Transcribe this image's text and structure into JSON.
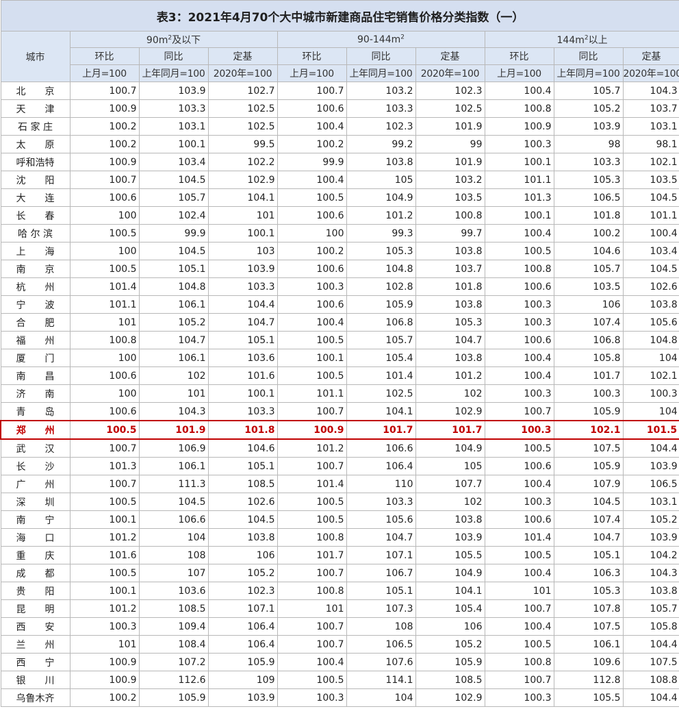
{
  "title": "表3：2021年4月70个大中城市新建商品住宅销售价格分类指数（一）",
  "city_header": "城市",
  "groups": [
    {
      "pre": "90m",
      "sup": "2",
      "post": "及以下"
    },
    {
      "pre": "90-144m",
      "sup": "2",
      "post": ""
    },
    {
      "pre": "144m",
      "sup": "2",
      "post": "以上"
    }
  ],
  "sub_headers": [
    "环比",
    "同比",
    "定基",
    "环比",
    "同比",
    "定基",
    "环比",
    "同比",
    "定基"
  ],
  "base_headers": [
    "上月=100",
    "上年同月=100",
    "2020年=100",
    "上月=100",
    "上年同月=100",
    "2020年=100",
    "上月=100",
    "上年同月=100",
    "2020年=100"
  ],
  "highlight_color": "#c00000",
  "rows": [
    {
      "city": "北　　京",
      "v": [
        "100.7",
        "103.9",
        "102.7",
        "100.7",
        "103.2",
        "102.3",
        "100.4",
        "105.7",
        "104.3"
      ]
    },
    {
      "city": "天　　津",
      "v": [
        "100.9",
        "103.3",
        "102.5",
        "100.6",
        "103.3",
        "102.5",
        "100.8",
        "105.2",
        "103.7"
      ]
    },
    {
      "city": "石 家 庄",
      "v": [
        "100.2",
        "103.1",
        "102.5",
        "100.4",
        "102.3",
        "101.9",
        "100.9",
        "103.9",
        "103.1"
      ]
    },
    {
      "city": "太　　原",
      "v": [
        "100.2",
        "100.1",
        "99.5",
        "100.2",
        "99.2",
        "99",
        "100.3",
        "98",
        "98.1"
      ]
    },
    {
      "city": "呼和浩特",
      "v": [
        "100.9",
        "103.4",
        "102.2",
        "99.9",
        "103.8",
        "101.9",
        "100.1",
        "103.3",
        "102.1"
      ]
    },
    {
      "city": "沈　　阳",
      "v": [
        "100.7",
        "104.5",
        "102.9",
        "100.4",
        "105",
        "103.2",
        "101.1",
        "105.3",
        "103.5"
      ]
    },
    {
      "city": "大　　连",
      "v": [
        "100.6",
        "105.7",
        "104.1",
        "100.5",
        "104.9",
        "103.5",
        "101.3",
        "106.5",
        "104.5"
      ]
    },
    {
      "city": "长　　春",
      "v": [
        "100",
        "102.4",
        "101",
        "100.6",
        "101.2",
        "100.8",
        "100.1",
        "101.8",
        "101.1"
      ]
    },
    {
      "city": "哈 尔 滨",
      "v": [
        "100.5",
        "99.9",
        "100.1",
        "100",
        "99.3",
        "99.7",
        "100.4",
        "100.2",
        "100.4"
      ]
    },
    {
      "city": "上　　海",
      "v": [
        "100",
        "104.5",
        "103",
        "100.2",
        "105.3",
        "103.8",
        "100.5",
        "104.6",
        "103.4"
      ]
    },
    {
      "city": "南　　京",
      "v": [
        "100.5",
        "105.1",
        "103.9",
        "100.6",
        "104.8",
        "103.7",
        "100.8",
        "105.7",
        "104.5"
      ]
    },
    {
      "city": "杭　　州",
      "v": [
        "101.4",
        "104.8",
        "103.3",
        "100.3",
        "102.8",
        "101.8",
        "100.6",
        "103.5",
        "102.6"
      ]
    },
    {
      "city": "宁　　波",
      "v": [
        "101.1",
        "106.1",
        "104.4",
        "100.6",
        "105.9",
        "103.8",
        "100.3",
        "106",
        "103.8"
      ]
    },
    {
      "city": "合　　肥",
      "v": [
        "101",
        "105.2",
        "104.7",
        "100.4",
        "106.8",
        "105.3",
        "100.3",
        "107.4",
        "105.6"
      ]
    },
    {
      "city": "福　　州",
      "v": [
        "100.8",
        "104.7",
        "105.1",
        "100.5",
        "105.7",
        "104.7",
        "100.6",
        "106.8",
        "104.8"
      ]
    },
    {
      "city": "厦　　门",
      "v": [
        "100",
        "106.1",
        "103.6",
        "100.1",
        "105.4",
        "103.8",
        "100.4",
        "105.8",
        "104"
      ]
    },
    {
      "city": "南　　昌",
      "v": [
        "100.6",
        "102",
        "101.6",
        "100.5",
        "101.4",
        "101.2",
        "100.4",
        "101.7",
        "102.1"
      ]
    },
    {
      "city": "济　　南",
      "v": [
        "100",
        "101",
        "100.1",
        "101.1",
        "102.5",
        "102",
        "100.3",
        "100.3",
        "100.3"
      ]
    },
    {
      "city": "青　　岛",
      "v": [
        "100.6",
        "104.3",
        "103.3",
        "100.7",
        "104.1",
        "102.9",
        "100.7",
        "105.9",
        "104"
      ]
    },
    {
      "city": "郑　　州",
      "highlight": true,
      "v": [
        "100.5",
        "101.9",
        "101.8",
        "100.9",
        "101.7",
        "101.7",
        "100.3",
        "102.1",
        "101.5"
      ]
    },
    {
      "city": "武　　汉",
      "v": [
        "100.7",
        "106.9",
        "104.6",
        "101.2",
        "106.6",
        "104.9",
        "100.5",
        "107.5",
        "104.4"
      ]
    },
    {
      "city": "长　　沙",
      "v": [
        "101.3",
        "106.1",
        "105.1",
        "100.7",
        "106.4",
        "105",
        "100.6",
        "105.9",
        "103.9"
      ]
    },
    {
      "city": "广　　州",
      "v": [
        "100.7",
        "111.3",
        "108.5",
        "101.4",
        "110",
        "107.7",
        "100.4",
        "107.9",
        "106.5"
      ]
    },
    {
      "city": "深　　圳",
      "v": [
        "100.5",
        "104.5",
        "102.6",
        "100.5",
        "103.3",
        "102",
        "100.3",
        "104.5",
        "103.1"
      ]
    },
    {
      "city": "南　　宁",
      "v": [
        "100.1",
        "106.6",
        "104.5",
        "100.5",
        "105.6",
        "103.8",
        "100.6",
        "107.4",
        "105.2"
      ]
    },
    {
      "city": "海　　口",
      "v": [
        "101.2",
        "104",
        "103.8",
        "100.8",
        "104.7",
        "103.9",
        "101.4",
        "104.7",
        "103.9"
      ]
    },
    {
      "city": "重　　庆",
      "v": [
        "101.6",
        "108",
        "106",
        "101.7",
        "107.1",
        "105.5",
        "100.5",
        "105.1",
        "104.2"
      ]
    },
    {
      "city": "成　　都",
      "v": [
        "100.5",
        "107",
        "105.2",
        "100.7",
        "106.7",
        "104.9",
        "100.4",
        "106.3",
        "104.3"
      ]
    },
    {
      "city": "贵　　阳",
      "v": [
        "100.1",
        "103.6",
        "102.3",
        "100.8",
        "105.1",
        "104.1",
        "101",
        "105.3",
        "103.8"
      ]
    },
    {
      "city": "昆　　明",
      "v": [
        "101.2",
        "108.5",
        "107.1",
        "101",
        "107.3",
        "105.4",
        "100.7",
        "107.8",
        "105.7"
      ]
    },
    {
      "city": "西　　安",
      "v": [
        "100.3",
        "109.4",
        "106.4",
        "100.7",
        "108",
        "106",
        "100.4",
        "107.5",
        "105.8"
      ]
    },
    {
      "city": "兰　　州",
      "v": [
        "101",
        "108.4",
        "106.4",
        "100.7",
        "106.5",
        "105.2",
        "100.5",
        "106.1",
        "104.4"
      ]
    },
    {
      "city": "西　　宁",
      "v": [
        "100.9",
        "107.2",
        "105.9",
        "100.4",
        "107.6",
        "105.9",
        "100.8",
        "109.6",
        "107.5"
      ]
    },
    {
      "city": "银　　川",
      "v": [
        "100.9",
        "112.6",
        "109",
        "100.5",
        "114.1",
        "108.5",
        "100.7",
        "112.8",
        "108.8"
      ]
    },
    {
      "city": "乌鲁木齐",
      "v": [
        "100.2",
        "105.9",
        "103.9",
        "100.3",
        "104",
        "102.9",
        "100.3",
        "105.5",
        "104.4"
      ]
    }
  ]
}
